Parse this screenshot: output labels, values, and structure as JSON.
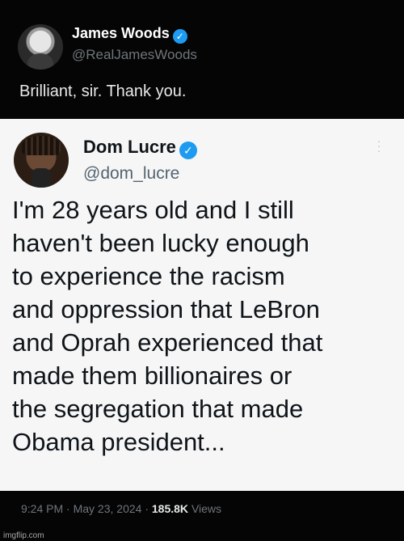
{
  "top_post": {
    "display_name": "James Woods",
    "handle": "@RealJamesWoods",
    "verified_icon": "verified-badge-icon",
    "text": "Brilliant, sir. Thank you."
  },
  "quoted_post": {
    "display_name": "Dom Lucre",
    "handle": "@dom_lucre",
    "verified_icon": "verified-badge-icon",
    "more_icon": "more-options-icon",
    "text_lines": [
      "I'm 28 years old and I still",
      "haven't been lucky enough",
      "to experience the racism",
      "and oppression that LeBron",
      "and Oprah experienced that",
      "made them billionaires or",
      "the segregation that made",
      "Obama president..."
    ]
  },
  "meta": {
    "time": "9:24 PM",
    "separator": "·",
    "date": "May 23, 2024",
    "views_count": "185.8K",
    "views_label": "Views"
  },
  "watermark": "imgflip.com",
  "colors": {
    "background_dark": "#050505",
    "quote_background": "#f6f6f6",
    "verified_blue": "#1d9bf0",
    "secondary_text": "#6f767b"
  }
}
